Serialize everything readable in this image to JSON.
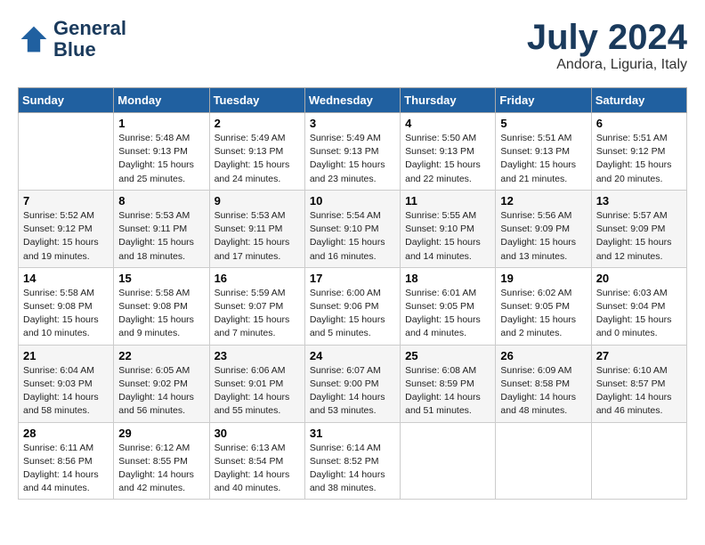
{
  "header": {
    "logo_line1": "General",
    "logo_line2": "Blue",
    "month_year": "July 2024",
    "location": "Andora, Liguria, Italy"
  },
  "days_of_week": [
    "Sunday",
    "Monday",
    "Tuesday",
    "Wednesday",
    "Thursday",
    "Friday",
    "Saturday"
  ],
  "weeks": [
    [
      {
        "day": "",
        "info": ""
      },
      {
        "day": "1",
        "info": "Sunrise: 5:48 AM\nSunset: 9:13 PM\nDaylight: 15 hours\nand 25 minutes."
      },
      {
        "day": "2",
        "info": "Sunrise: 5:49 AM\nSunset: 9:13 PM\nDaylight: 15 hours\nand 24 minutes."
      },
      {
        "day": "3",
        "info": "Sunrise: 5:49 AM\nSunset: 9:13 PM\nDaylight: 15 hours\nand 23 minutes."
      },
      {
        "day": "4",
        "info": "Sunrise: 5:50 AM\nSunset: 9:13 PM\nDaylight: 15 hours\nand 22 minutes."
      },
      {
        "day": "5",
        "info": "Sunrise: 5:51 AM\nSunset: 9:13 PM\nDaylight: 15 hours\nand 21 minutes."
      },
      {
        "day": "6",
        "info": "Sunrise: 5:51 AM\nSunset: 9:12 PM\nDaylight: 15 hours\nand 20 minutes."
      }
    ],
    [
      {
        "day": "7",
        "info": "Sunrise: 5:52 AM\nSunset: 9:12 PM\nDaylight: 15 hours\nand 19 minutes."
      },
      {
        "day": "8",
        "info": "Sunrise: 5:53 AM\nSunset: 9:11 PM\nDaylight: 15 hours\nand 18 minutes."
      },
      {
        "day": "9",
        "info": "Sunrise: 5:53 AM\nSunset: 9:11 PM\nDaylight: 15 hours\nand 17 minutes."
      },
      {
        "day": "10",
        "info": "Sunrise: 5:54 AM\nSunset: 9:10 PM\nDaylight: 15 hours\nand 16 minutes."
      },
      {
        "day": "11",
        "info": "Sunrise: 5:55 AM\nSunset: 9:10 PM\nDaylight: 15 hours\nand 14 minutes."
      },
      {
        "day": "12",
        "info": "Sunrise: 5:56 AM\nSunset: 9:09 PM\nDaylight: 15 hours\nand 13 minutes."
      },
      {
        "day": "13",
        "info": "Sunrise: 5:57 AM\nSunset: 9:09 PM\nDaylight: 15 hours\nand 12 minutes."
      }
    ],
    [
      {
        "day": "14",
        "info": "Sunrise: 5:58 AM\nSunset: 9:08 PM\nDaylight: 15 hours\nand 10 minutes."
      },
      {
        "day": "15",
        "info": "Sunrise: 5:58 AM\nSunset: 9:08 PM\nDaylight: 15 hours\nand 9 minutes."
      },
      {
        "day": "16",
        "info": "Sunrise: 5:59 AM\nSunset: 9:07 PM\nDaylight: 15 hours\nand 7 minutes."
      },
      {
        "day": "17",
        "info": "Sunrise: 6:00 AM\nSunset: 9:06 PM\nDaylight: 15 hours\nand 5 minutes."
      },
      {
        "day": "18",
        "info": "Sunrise: 6:01 AM\nSunset: 9:05 PM\nDaylight: 15 hours\nand 4 minutes."
      },
      {
        "day": "19",
        "info": "Sunrise: 6:02 AM\nSunset: 9:05 PM\nDaylight: 15 hours\nand 2 minutes."
      },
      {
        "day": "20",
        "info": "Sunrise: 6:03 AM\nSunset: 9:04 PM\nDaylight: 15 hours\nand 0 minutes."
      }
    ],
    [
      {
        "day": "21",
        "info": "Sunrise: 6:04 AM\nSunset: 9:03 PM\nDaylight: 14 hours\nand 58 minutes."
      },
      {
        "day": "22",
        "info": "Sunrise: 6:05 AM\nSunset: 9:02 PM\nDaylight: 14 hours\nand 56 minutes."
      },
      {
        "day": "23",
        "info": "Sunrise: 6:06 AM\nSunset: 9:01 PM\nDaylight: 14 hours\nand 55 minutes."
      },
      {
        "day": "24",
        "info": "Sunrise: 6:07 AM\nSunset: 9:00 PM\nDaylight: 14 hours\nand 53 minutes."
      },
      {
        "day": "25",
        "info": "Sunrise: 6:08 AM\nSunset: 8:59 PM\nDaylight: 14 hours\nand 51 minutes."
      },
      {
        "day": "26",
        "info": "Sunrise: 6:09 AM\nSunset: 8:58 PM\nDaylight: 14 hours\nand 48 minutes."
      },
      {
        "day": "27",
        "info": "Sunrise: 6:10 AM\nSunset: 8:57 PM\nDaylight: 14 hours\nand 46 minutes."
      }
    ],
    [
      {
        "day": "28",
        "info": "Sunrise: 6:11 AM\nSunset: 8:56 PM\nDaylight: 14 hours\nand 44 minutes."
      },
      {
        "day": "29",
        "info": "Sunrise: 6:12 AM\nSunset: 8:55 PM\nDaylight: 14 hours\nand 42 minutes."
      },
      {
        "day": "30",
        "info": "Sunrise: 6:13 AM\nSunset: 8:54 PM\nDaylight: 14 hours\nand 40 minutes."
      },
      {
        "day": "31",
        "info": "Sunrise: 6:14 AM\nSunset: 8:52 PM\nDaylight: 14 hours\nand 38 minutes."
      },
      {
        "day": "",
        "info": ""
      },
      {
        "day": "",
        "info": ""
      },
      {
        "day": "",
        "info": ""
      }
    ]
  ]
}
